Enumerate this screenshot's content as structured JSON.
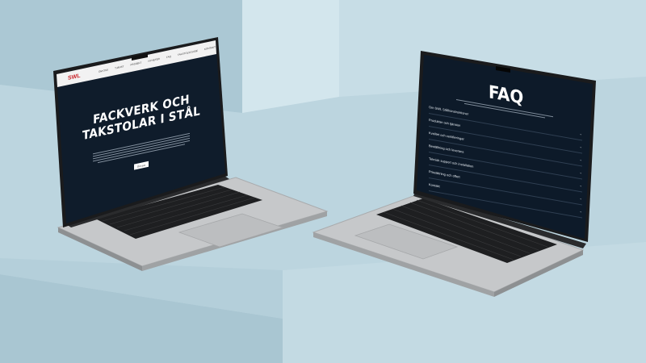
{
  "scene": {
    "colors": {
      "background": "#b9d2dc",
      "laptop_body": "#c9cbcd",
      "screen_navy": "#0e1c2c",
      "accent_red": "#c9262c"
    }
  },
  "left_laptop": {
    "logo_text": "SWL",
    "nav_items": [
      "OM OSS",
      "TJÄNST",
      "PROJEKT",
      "NYHETER",
      "FAQ",
      "TAKSTOLSGUIDE",
      "KONTAKT"
    ],
    "hero_title_line1": "FACKVERK OCH",
    "hero_title_line2": "TAKSTOLAR I STÅL",
    "hero_cta": "Om oss"
  },
  "right_laptop": {
    "faq_title": "FAQ",
    "faq_items": [
      "Om SWL Stålkonstruktioner",
      "Produkter och tjänster",
      "Kvalitet och certifieringar",
      "Beställning och leverans",
      "Teknisk support och installation",
      "Prissättning och offert",
      "Kontakt"
    ]
  }
}
